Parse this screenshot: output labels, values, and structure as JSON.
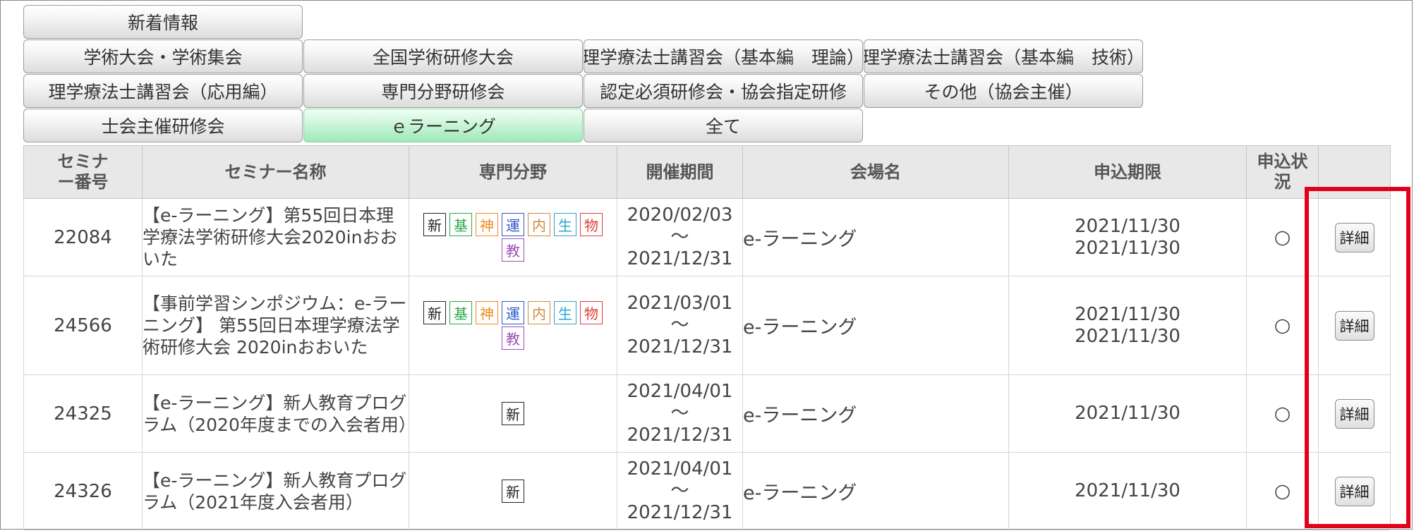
{
  "tabs": [
    {
      "label": "新着情報",
      "active": false
    },
    {
      "label": "学術大会・学術集会",
      "active": false
    },
    {
      "label": "全国学術研修大会",
      "active": false
    },
    {
      "label": "理学療法士講習会（基本編　理論）",
      "active": false
    },
    {
      "label": "理学療法士講習会（基本編　技術）",
      "active": false
    },
    {
      "label": "理学療法士講習会（応用編）",
      "active": false
    },
    {
      "label": "専門分野研修会",
      "active": false
    },
    {
      "label": "認定必須研修会・協会指定研修",
      "active": false
    },
    {
      "label": "その他（協会主催）",
      "active": false
    },
    {
      "label": "士会主催研修会",
      "active": false
    },
    {
      "label": "ｅラーニング",
      "active": true
    },
    {
      "label": "全て",
      "active": false
    }
  ],
  "table": {
    "headers": {
      "number": "セミナー番号",
      "name": "セミナー名称",
      "field": "専門分野",
      "period": "開催期間",
      "venue": "会場名",
      "deadline": "申込期限",
      "status": "申込状況",
      "detail": ""
    },
    "field_tags": {
      "新": {
        "color": "#222222",
        "icon": "new-tag"
      },
      "基": {
        "color": "#2aa84a",
        "icon": "basic-tag"
      },
      "神": {
        "color": "#f08a24",
        "icon": "neuro-tag"
      },
      "運": {
        "color": "#2b57c8",
        "icon": "motor-tag"
      },
      "内": {
        "color": "#d08a3c",
        "icon": "internal-tag"
      },
      "生": {
        "color": "#29a3d6",
        "icon": "life-tag"
      },
      "物": {
        "color": "#e03a3a",
        "icon": "physical-tag"
      },
      "教": {
        "color": "#9b4fb5",
        "icon": "education-tag"
      }
    },
    "rows": [
      {
        "number": "22084",
        "name": "【e-ラーニング】第55回日本理学療法学術研修大会2020inおおいた",
        "fields": [
          [
            "新",
            "基",
            "神",
            "運",
            "内",
            "生",
            "物"
          ],
          [
            "教"
          ]
        ],
        "period_start": "2020/02/03",
        "period_sep": "～",
        "period_end": "2021/12/31",
        "venue": "e-ラーニング",
        "deadline_1": "2021/11/30",
        "deadline_2": "2021/11/30",
        "status": "○",
        "detail_label": "詳細"
      },
      {
        "number": "24566",
        "name": "【事前学習シンポジウム：e-ラーニング】 第55回日本理学療法学術研修大会 2020inおおいた",
        "fields": [
          [
            "新",
            "基",
            "神",
            "運",
            "内",
            "生",
            "物"
          ],
          [
            "教"
          ]
        ],
        "period_start": "2021/03/01",
        "period_sep": "～",
        "period_end": "2021/12/31",
        "venue": "e-ラーニング",
        "deadline_1": "2021/11/30",
        "deadline_2": "2021/11/30",
        "status": "○",
        "detail_label": "詳細"
      },
      {
        "number": "24325",
        "name": "【e-ラーニング】新人教育プログラム（2020年度までの入会者用）",
        "fields": [
          [
            "新"
          ]
        ],
        "period_start": "2021/04/01",
        "period_sep": "～",
        "period_end": "2021/12/31",
        "venue": "e-ラーニング",
        "deadline_1": "2021/11/30",
        "deadline_2": "",
        "status": "○",
        "detail_label": "詳細"
      },
      {
        "number": "24326",
        "name": "【e-ラーニング】新人教育プログラム（2021年度入会者用）",
        "fields": [
          [
            "新"
          ]
        ],
        "period_start": "2021/04/01",
        "period_sep": "～",
        "period_end": "2021/12/31",
        "venue": "e-ラーニング",
        "deadline_1": "2021/11/30",
        "deadline_2": "",
        "status": "○",
        "detail_label": "詳細"
      }
    ]
  },
  "highlight": {
    "color": "#e3001b"
  }
}
